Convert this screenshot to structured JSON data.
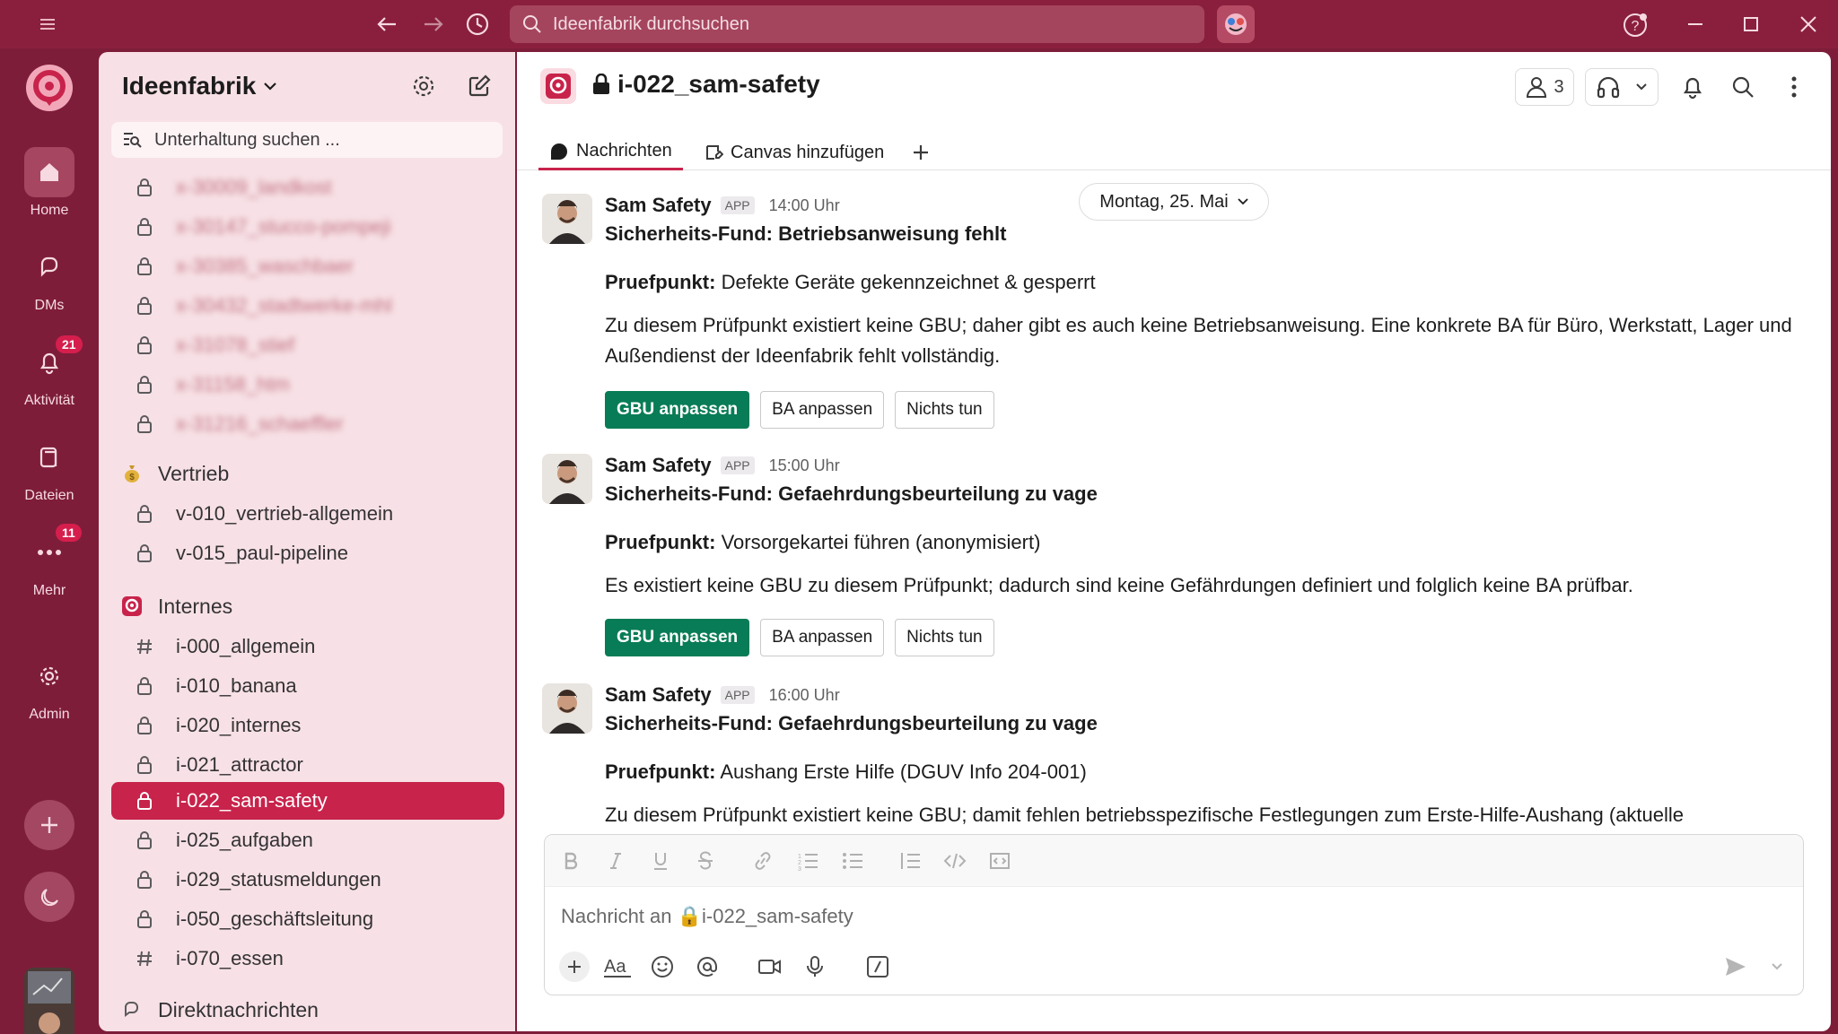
{
  "titlebar": {
    "search_placeholder": "Ideenfabrik durchsuchen"
  },
  "rail": {
    "home": "Home",
    "dms": "DMs",
    "activity": "Aktivität",
    "activity_badge": "21",
    "files": "Dateien",
    "more": "Mehr",
    "more_badge": "11",
    "admin": "Admin"
  },
  "sidebar": {
    "workspace": "Ideenfabrik",
    "search_placeholder": "Unterhaltung suchen ...",
    "blurred_channels": [
      "x-30009_landkost",
      "x-30147_stucco-pompeji",
      "x-30385_waschbaer",
      "x-30432_stadtwerke-mhl",
      "x-31078_stief",
      "x-31158_htm",
      "x-31216_schaeffler"
    ],
    "section_sales": "Vertrieb",
    "sales_channels": [
      "v-010_vertrieb-allgemein",
      "v-015_paul-pipeline"
    ],
    "section_internal": "Internes",
    "internal_channels": [
      "i-000_allgemein",
      "i-010_banana",
      "i-020_internes",
      "i-021_attractor",
      "i-022_sam-safety",
      "i-025_aufgaben",
      "i-029_statusmeldungen",
      "i-050_geschäftsleitung",
      "i-070_essen"
    ],
    "section_dm": "Direktnachrichten"
  },
  "channel": {
    "name": "i-022_sam-safety",
    "member_count": "3",
    "tab_messages": "Nachrichten",
    "tab_canvas": "Canvas hinzufügen",
    "date_pill": "Montag, 25. Mai"
  },
  "messages": [
    {
      "sender": "Sam Safety",
      "tag": "APP",
      "time": "14:00 Uhr",
      "title": "Sicherheits-Fund: Betriebsanweisung fehlt",
      "check_label": "Pruefpunkt:",
      "check_value": "Defekte Geräte gekennzeichnet & gesperrt",
      "body": "Zu diesem Prüfpunkt existiert keine GBU; daher gibt es auch keine Betriebsanweisung. Eine konkrete BA für Büro, Werkstatt, Lager und Außendienst der Ideenfabrik fehlt vollständig.",
      "btn1": "GBU anpassen",
      "btn2": "BA anpassen",
      "btn3": "Nichts tun"
    },
    {
      "sender": "Sam Safety",
      "tag": "APP",
      "time": "15:00 Uhr",
      "title": "Sicherheits-Fund: Gefaehrdungsbeurteilung zu vage",
      "check_label": "Pruefpunkt:",
      "check_value": "Vorsorgekartei führen (anonymisiert)",
      "body": "Es existiert keine GBU zu diesem Prüfpunkt; dadurch sind keine Gefährdungen definiert und folglich keine BA prüfbar.",
      "btn1": "GBU anpassen",
      "btn2": "BA anpassen",
      "btn3": "Nichts tun"
    },
    {
      "sender": "Sam Safety",
      "tag": "APP",
      "time": "16:00 Uhr",
      "title": "Sicherheits-Fund: Gefaehrdungsbeurteilung zu vage",
      "check_label": "Pruefpunkt:",
      "check_value": "Aushang Erste Hilfe (DGUV Info 204-001)",
      "body": "Zu diesem Prüfpunkt existiert keine GBU; damit fehlen betriebsspezifische Festlegungen zum Erste-Hilfe-Aushang (aktuelle"
    }
  ],
  "composer": {
    "placeholder": "Nachricht an 🔒i-022_sam-safety"
  },
  "colors": {
    "brand": "#8a1f3d",
    "active_channel": "#c8234b",
    "primary_button": "#087c56"
  }
}
